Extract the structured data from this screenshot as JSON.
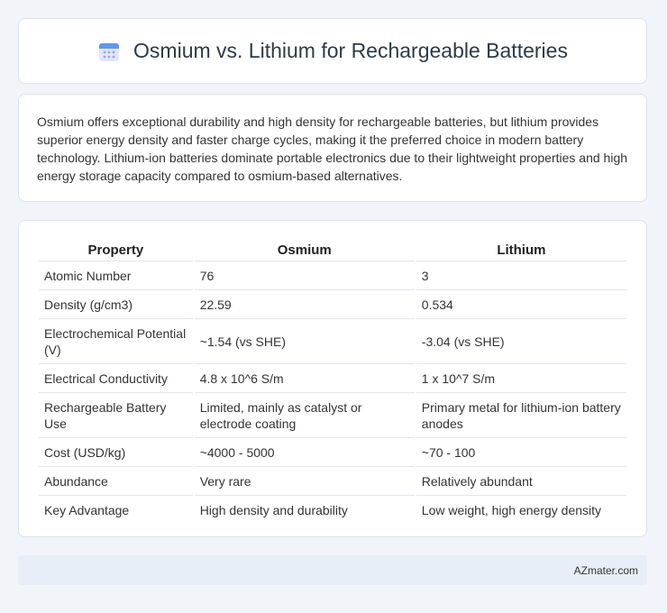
{
  "header": {
    "title": "Osmium vs. Lithium for Rechargeable Batteries",
    "icon": "calendar-icon"
  },
  "summary": {
    "text": "Osmium offers exceptional durability and high density for rechargeable batteries, but lithium provides superior energy density and faster charge cycles, making it the preferred choice in modern battery technology. Lithium-ion batteries dominate portable electronics due to their lightweight properties and high energy storage capacity compared to osmium-based alternatives."
  },
  "table": {
    "headers": [
      "Property",
      "Osmium",
      "Lithium"
    ],
    "rows": [
      [
        "Atomic Number",
        "76",
        "3"
      ],
      [
        "Density (g/cm3)",
        "22.59",
        "0.534"
      ],
      [
        "Electrochemical Potential (V)",
        "~1.54 (vs SHE)",
        "-3.04 (vs SHE)"
      ],
      [
        "Electrical Conductivity",
        "4.8 x 10^6 S/m",
        "1 x 10^7 S/m"
      ],
      [
        "Rechargeable Battery Use",
        "Limited, mainly as catalyst or electrode coating",
        "Primary metal for lithium-ion battery anodes"
      ],
      [
        "Cost (USD/kg)",
        "~4000 - 5000",
        "~70 - 100"
      ],
      [
        "Abundance",
        "Very rare",
        "Relatively abundant"
      ],
      [
        "Key Advantage",
        "High density and durability",
        "Low weight, high energy density"
      ]
    ]
  },
  "footer": {
    "site": "AZmater.com"
  },
  "colors": {
    "page_background": "#f1f4f9",
    "card_background": "#ffffff",
    "footer_background": "#e8eef7",
    "icon_top": "#5b9bf0",
    "icon_body": "#dfe7fb",
    "icon_dots": "#9aa4ef"
  }
}
